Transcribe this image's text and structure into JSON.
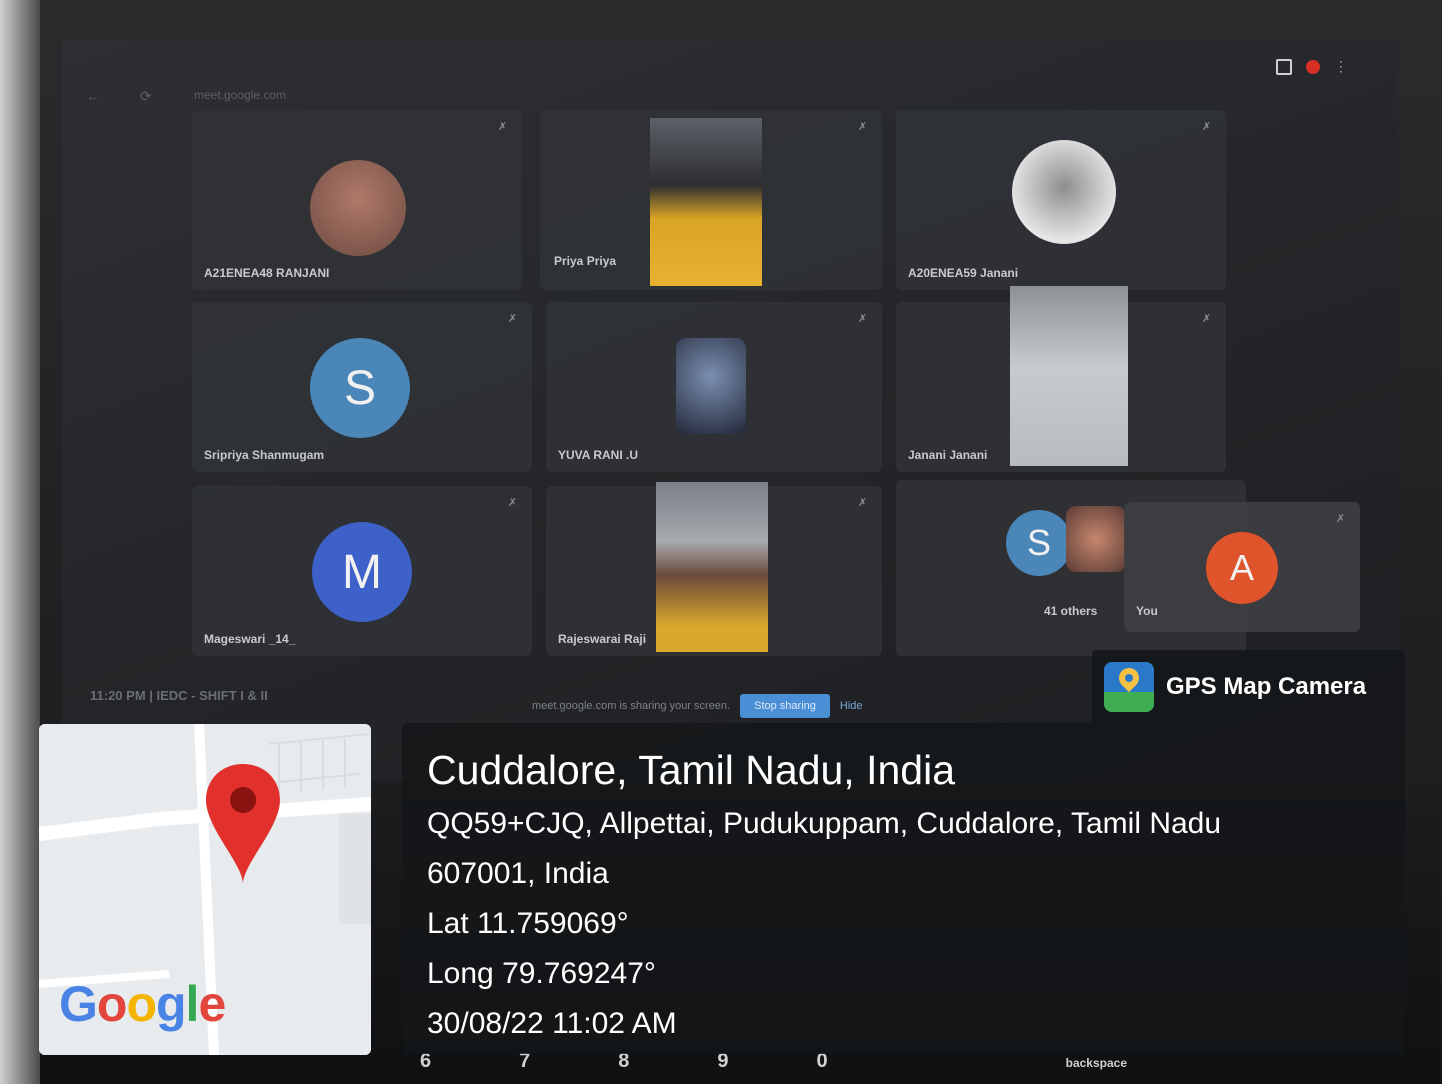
{
  "screen": {
    "url": "meet.google.com",
    "participants": [
      {
        "name": "A21ENEA48 RANJANI",
        "type": "photo"
      },
      {
        "name": "Priya Priya",
        "type": "video"
      },
      {
        "name": "A20ENEA59 Janani",
        "type": "photo"
      },
      {
        "name": "Sripriya Shanmugam",
        "type": "initial",
        "initial": "S",
        "color": "#4a86b8"
      },
      {
        "name": "YUVA RANI .U",
        "type": "photo"
      },
      {
        "name": "Janani Janani",
        "type": "video"
      },
      {
        "name": "Mageswari _14_",
        "type": "initial",
        "initial": "M",
        "color": "#3d61c9"
      },
      {
        "name": "Rajeswarai Raji",
        "type": "video"
      }
    ],
    "others": {
      "initial": "S",
      "label": "41 others"
    },
    "you": {
      "label": "You",
      "initial": "A",
      "color": "#e0542c"
    },
    "meeting_line": "11:20 PM  |  IEDC - SHIFT I & II",
    "share_text": "meet.google.com is sharing your screen.",
    "stop_sharing": "Stop sharing",
    "hide": "Hide"
  },
  "keyboard": {
    "keys": [
      "6",
      "7",
      "8",
      "9",
      "0",
      "backspace"
    ]
  },
  "gps": {
    "brand": "GPS Map Camera",
    "location_title": "Cuddalore, Tamil Nadu, India",
    "address_line1": "QQ59+CJQ, Allpettai, Pudukuppam, Cuddalore, Tamil Nadu",
    "address_line2": "607001, India",
    "lat": "Lat 11.759069°",
    "long": "Long 79.769247°",
    "datetime": "30/08/22 11:02 AM",
    "map_logo": "Google"
  }
}
